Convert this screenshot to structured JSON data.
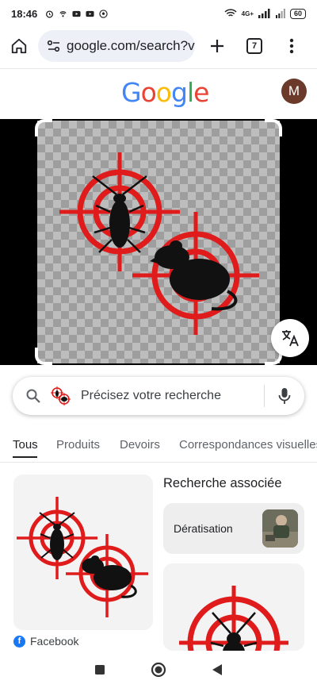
{
  "status": {
    "time": "18:46",
    "battery": "60",
    "network": "4G+"
  },
  "browser": {
    "url": "google.com/search?vs",
    "tab_count": "7"
  },
  "header": {
    "logo": "Google",
    "avatar_letter": "M"
  },
  "search": {
    "placeholder": "Précisez votre recherche"
  },
  "filters": [
    "Tous",
    "Produits",
    "Devoirs",
    "Correspondances visuelles"
  ],
  "results": {
    "main_source": "Facebook",
    "related_title": "Recherche associée",
    "related_chip": "Dératisation"
  },
  "colors": {
    "target_red": "#e01b1b",
    "accent_blue": "#1a73e8",
    "facebook_blue": "#1877f2"
  }
}
